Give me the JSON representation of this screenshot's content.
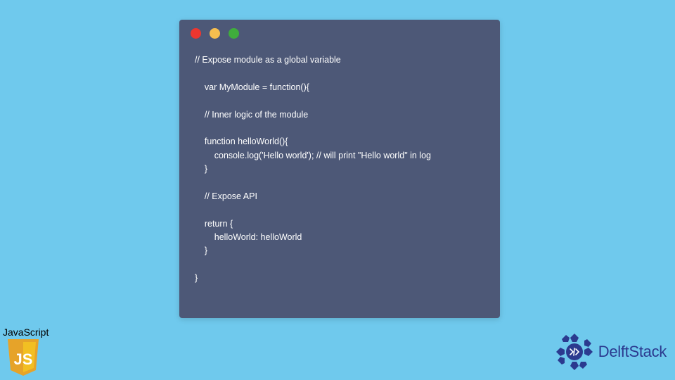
{
  "window": {
    "colors": {
      "red": "#ed362f",
      "yellow": "#f5be4f",
      "green": "#3fad3c",
      "bg": "#4d5877"
    }
  },
  "code": {
    "lines": "// Expose module as a global variable\n\n    var MyModule = function(){\n\n    // Inner logic of the module\n\n    function helloWorld(){\n        console.log('Hello world'); // will print \"Hello world\" in log\n    }\n\n    // Expose API\n\n    return {\n        helloWorld: helloWorld\n    }\n\n}"
  },
  "badge": {
    "label": "JavaScript",
    "shield_text": "JS"
  },
  "brand": {
    "name": "DelftStack"
  }
}
